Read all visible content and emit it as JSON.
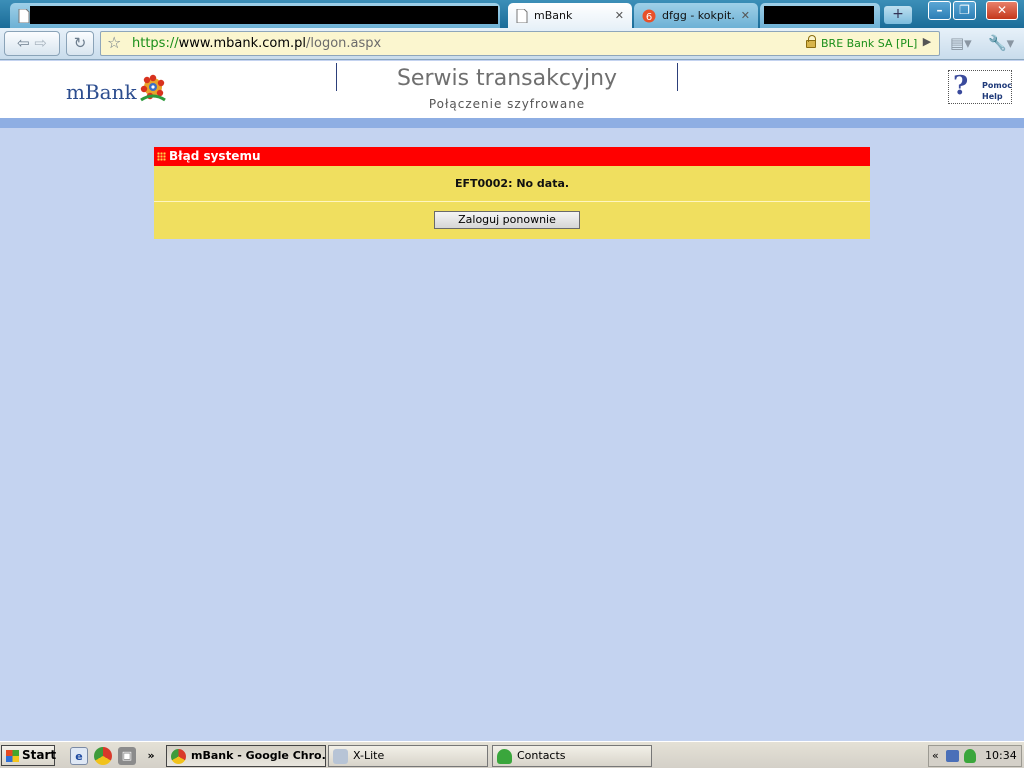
{
  "browser": {
    "tabs": [
      {
        "label": "mBank",
        "active": true
      },
      {
        "label": "dfgg - kokpit…",
        "active": false
      }
    ],
    "new_tab_icon": "plus-icon",
    "window_controls": [
      "minimize-icon",
      "restore-icon",
      "close-icon"
    ],
    "url": {
      "scheme": "https://",
      "host": "www.mbank.com.pl",
      "path": "/logon.aspx"
    },
    "security_label": "BRE Bank SA [PL]",
    "tab_close_glyph": "✕"
  },
  "header": {
    "logo_text": "mBank",
    "title": "Serwis transakcyjny",
    "subtitle": "Połączenie szyfrowane",
    "help_line1": "Pomoc",
    "help_line2": "Help"
  },
  "error": {
    "title": "Błąd systemu",
    "message": "EFT0002: No data.",
    "button_label": "Zaloguj ponownie"
  },
  "taskbar": {
    "start_label": "Start",
    "quicklaunch_more": "»",
    "tasks": [
      {
        "label": "mBank - Google Chro...",
        "active": true
      },
      {
        "label": "X-Lite",
        "active": false
      },
      {
        "label": "Contacts",
        "active": false
      }
    ],
    "tray_chevron": "«",
    "clock": "10:34"
  },
  "colors": {
    "page_background": "#c4d3f0",
    "error_header": "#ff0000",
    "error_body": "#f0df5f",
    "secure_green": "#1a8f1a"
  }
}
